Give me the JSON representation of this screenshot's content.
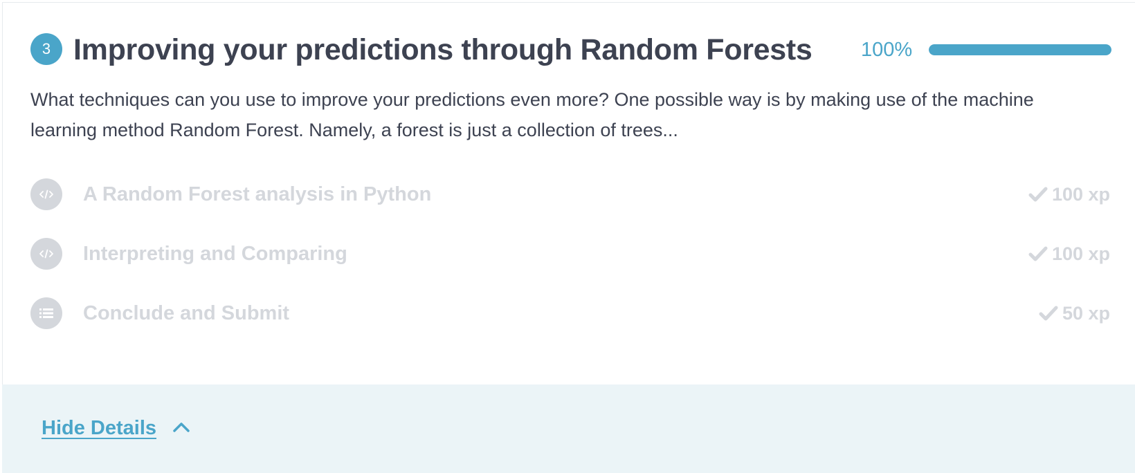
{
  "chapter": {
    "number": "3",
    "title": "Improving your predictions through Random Forests",
    "progress_label": "100%",
    "progress_fraction": 1.0,
    "description": "What techniques can you use to improve your predictions even more? One possible way is by making use of the machine learning method Random Forest. Namely, a forest is just a collection of trees..."
  },
  "exercises": [
    {
      "title": "A Random Forest analysis in Python",
      "xp": "100 xp",
      "icon": "code-icon",
      "completed": true
    },
    {
      "title": "Interpreting and Comparing",
      "xp": "100 xp",
      "icon": "code-icon",
      "completed": true
    },
    {
      "title": "Conclude and Submit",
      "xp": "50 xp",
      "icon": "list-icon",
      "completed": true
    }
  ],
  "footer": {
    "hide_details_label": "Hide Details"
  },
  "colors": {
    "accent": "#4aa5c9",
    "title_text": "#3d4251",
    "muted": "#d4d7dc",
    "footer_bg": "#ebf4f7"
  }
}
